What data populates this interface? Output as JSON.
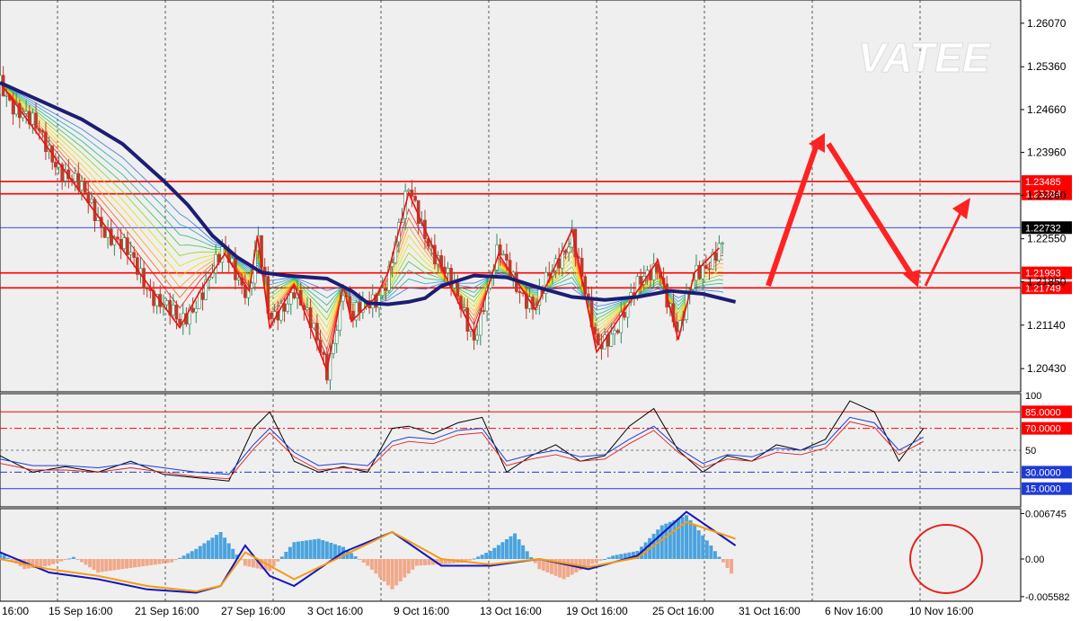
{
  "watermark": "VATEE",
  "colors": {
    "background": "#ffffff",
    "plot_bg": "#efefef",
    "grid": "#333333",
    "level_red": "#ff0000",
    "blue_line": "#1f3bd6",
    "ma_main": "#1c1d74",
    "bull": "#2e8b57",
    "bear": "#c0392b",
    "hist_pos": "#4aa3df",
    "hist_neg": "#f0a98a",
    "signal": "#f39c12"
  },
  "chart_data": [
    {
      "type": "line",
      "panel": "price",
      "y_ticks": [
        "1.26070",
        "1.25360",
        "1.24660",
        "1.23960",
        "1.23260",
        "1.22550",
        "1.21850",
        "1.21140",
        "1.20430"
      ],
      "ylim": [
        1.2008,
        1.2642
      ],
      "x_tick_labels": [
        "16:00",
        "15 Sep 16:00",
        "21 Sep 16:00",
        "27 Sep 16:00",
        "3 Oct 16:00",
        "9 Oct 16:00",
        "13 Oct 16:00",
        "19 Oct 16:00",
        "25 Oct 16:00",
        "31 Oct 16:00",
        "6 Nov 16:00",
        "10 Nov 16:00"
      ],
      "levels": [
        {
          "label": "1.23485",
          "value": 1.23485,
          "color": "#ff0000"
        },
        {
          "label": "1.23284",
          "value": 1.23284,
          "color": "#ff0000"
        },
        {
          "label": "1.22732",
          "value": 1.22732,
          "color": "#1f3bd6"
        },
        {
          "label": "1.21993",
          "value": 1.21993,
          "color": "#ff0000"
        },
        {
          "label": "1.21749",
          "value": 1.21749,
          "color": "#ff0000"
        }
      ],
      "current_price": "1.22732",
      "series": [
        {
          "role": "price",
          "x": [
            0,
            6,
            12,
            18,
            24,
            30,
            36,
            42,
            48,
            54,
            60,
            66,
            72,
            78,
            84,
            90,
            96,
            102,
            108,
            114,
            120,
            126,
            132,
            138,
            144,
            150,
            156,
            162,
            168,
            174,
            180
          ],
          "values": [
            1.25,
            1.247,
            1.243,
            1.24,
            1.24,
            1.235,
            1.229,
            1.222,
            1.215,
            1.2115,
            1.223,
            1.226,
            1.217,
            1.211,
            1.205,
            1.216,
            1.211,
            1.225,
            1.233,
            1.226,
            1.217,
            1.218,
            1.209,
            1.226,
            1.216,
            1.207,
            1.212,
            1.212,
            1.215,
            1.21,
            1.224
          ]
        },
        {
          "role": "zigzag",
          "x": [
            0,
            44,
            49,
            55,
            61,
            63,
            66,
            72,
            80,
            84,
            86,
            92,
            95,
            100,
            110,
            116,
            122,
            131,
            140,
            146,
            154,
            161,
            166,
            170,
            176
          ],
          "values": [
            1.251,
            1.211,
            1.217,
            1.223,
            1.217,
            1.226,
            1.211,
            1.218,
            1.204,
            1.218,
            1.212,
            1.216,
            1.22,
            1.233,
            1.218,
            1.21,
            1.223,
            1.214,
            1.227,
            1.207,
            1.215,
            1.222,
            1.209,
            1.22,
            1.224
          ]
        },
        {
          "role": "moving_average",
          "x": [
            0,
            10,
            20,
            30,
            40,
            46,
            52,
            58,
            64,
            70,
            80,
            86,
            90,
            95,
            100,
            104,
            108,
            116,
            124,
            132,
            140,
            148,
            156,
            164,
            172,
            180,
            188,
            196,
            204,
            212,
            220,
            230
          ],
          "values": [
            1.251,
            1.248,
            1.245,
            1.241,
            1.235,
            1.231,
            1.226,
            1.2225,
            1.22,
            1.2195,
            1.219,
            1.217,
            1.215,
            1.2148,
            1.2152,
            1.2158,
            1.2178,
            1.2195,
            1.2192,
            1.2175,
            1.216,
            1.2155,
            1.216,
            1.217,
            1.2165,
            1.2152,
            1.215,
            1.2155,
            1.217,
            1.22,
            1.226,
            1.227
          ]
        }
      ]
    },
    {
      "type": "line",
      "panel": "oscillator",
      "y_ticks": [
        "100",
        "50"
      ],
      "ylim": [
        0,
        100
      ],
      "levels": [
        {
          "label": "85.0000",
          "value": 85,
          "color": "#ff0000"
        },
        {
          "label": "70.0000",
          "value": 70,
          "color": "#ff0000"
        },
        {
          "label": "30.0000",
          "value": 30,
          "color": "#1f3bd6"
        },
        {
          "label": "15.0000",
          "value": 15,
          "color": "#1f3bd6"
        }
      ],
      "series": [
        {
          "x": [
            0,
            8,
            16,
            24,
            32,
            40,
            48,
            56,
            62,
            66,
            72,
            78,
            84,
            90,
            96,
            100,
            106,
            112,
            118,
            124,
            130,
            136,
            142,
            148,
            154,
            160,
            166,
            172,
            178,
            184,
            190,
            196,
            202,
            208,
            214,
            220,
            226
          ],
          "values": [
            45,
            30,
            35,
            30,
            40,
            28,
            25,
            22,
            70,
            85,
            40,
            30,
            35,
            30,
            70,
            72,
            65,
            75,
            80,
            30,
            45,
            55,
            40,
            45,
            72,
            88,
            50,
            30,
            45,
            40,
            55,
            50,
            60,
            95,
            85,
            40,
            70
          ]
        },
        {
          "x": [
            0,
            8,
            16,
            24,
            32,
            40,
            48,
            56,
            62,
            66,
            72,
            78,
            84,
            90,
            96,
            100,
            106,
            112,
            118,
            124,
            130,
            136,
            142,
            148,
            154,
            160,
            166,
            172,
            178,
            184,
            190,
            196,
            202,
            208,
            214,
            220,
            226
          ],
          "values": [
            42,
            36,
            36,
            34,
            38,
            34,
            30,
            28,
            55,
            70,
            48,
            36,
            38,
            36,
            58,
            62,
            60,
            68,
            70,
            40,
            46,
            50,
            44,
            46,
            60,
            72,
            52,
            38,
            46,
            44,
            52,
            50,
            56,
            80,
            75,
            50,
            62
          ]
        }
      ]
    },
    {
      "type": "bar",
      "panel": "macd",
      "y_ticks": [
        "0.006745",
        "0.00",
        "-0.005582"
      ],
      "ylim": [
        -0.006,
        0.0072
      ],
      "series": [
        {
          "role": "histogram",
          "x": [
            0,
            6,
            12,
            18,
            24,
            30,
            36,
            42,
            48,
            54,
            60,
            66,
            72,
            78,
            84,
            90,
            96,
            102,
            108,
            114,
            120,
            126,
            132,
            138,
            144,
            150,
            156,
            162,
            168,
            174,
            180,
            186,
            192,
            198,
            204,
            210,
            216,
            222,
            228
          ],
          "values": [
            0.001,
            -0.0015,
            -0.001,
            0.0003,
            -0.002,
            -0.0015,
            -0.001,
            -0.0005,
            0.0015,
            0.004,
            -0.001,
            -0.0018,
            0.0025,
            0.003,
            0.0018,
            -0.001,
            -0.0045,
            -0.001,
            -0.0008,
            -0.0005,
            0.0012,
            0.0038,
            -0.0015,
            -0.003,
            -0.001,
            0.0005,
            0.0012,
            0.005,
            0.0065,
            0.002,
            -0.003,
            -0.005,
            -0.003,
            -0.001,
            0.0015,
            0.001,
            0.0005,
            0.0008,
            0.0002
          ]
        },
        {
          "role": "macd",
          "x": [
            0,
            12,
            24,
            36,
            48,
            54,
            60,
            66,
            72,
            84,
            96,
            108,
            120,
            132,
            144,
            156,
            168,
            180,
            192,
            204,
            216,
            228
          ],
          "values": [
            0.001,
            -0.002,
            -0.003,
            -0.0045,
            -0.005,
            -0.004,
            0.002,
            -0.0025,
            -0.004,
            0.001,
            0.004,
            -0.001,
            -0.001,
            0.0,
            -0.0015,
            0.0005,
            0.007,
            0.002,
            -0.003,
            -0.0015,
            0.001,
            0.0005
          ]
        },
        {
          "role": "signal",
          "x": [
            0,
            12,
            24,
            36,
            48,
            54,
            60,
            66,
            72,
            84,
            96,
            108,
            120,
            132,
            144,
            156,
            168,
            180,
            192,
            204,
            216,
            228
          ],
          "values": [
            0.0,
            -0.0015,
            -0.0025,
            -0.004,
            -0.0048,
            -0.004,
            0.001,
            -0.001,
            -0.003,
            0.0005,
            0.004,
            0.0,
            -0.0008,
            0.0,
            -0.0012,
            0.0002,
            0.0055,
            0.003,
            -0.0015,
            -0.0012,
            0.0005,
            0.0002
          ]
        }
      ]
    }
  ]
}
